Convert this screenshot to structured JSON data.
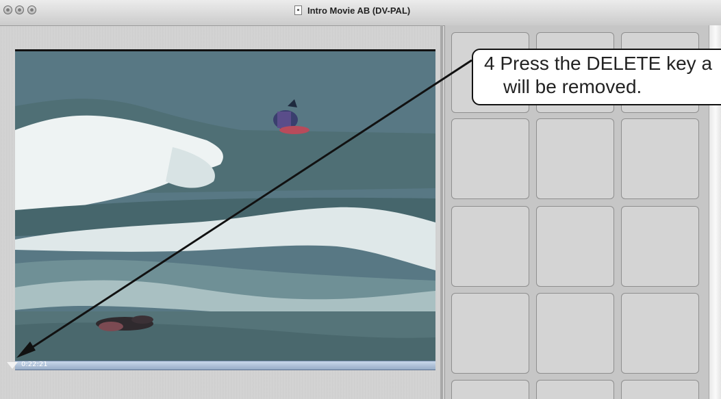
{
  "window": {
    "title": "Intro Movie AB (DV-PAL)"
  },
  "viewer": {
    "timecode": "0:22:21"
  },
  "callout": {
    "line1": "4  Press the DELETE key a",
    "line2": "will be removed."
  },
  "colors": {
    "callout_border": "#111111",
    "timebar": "#9fb3cc"
  }
}
